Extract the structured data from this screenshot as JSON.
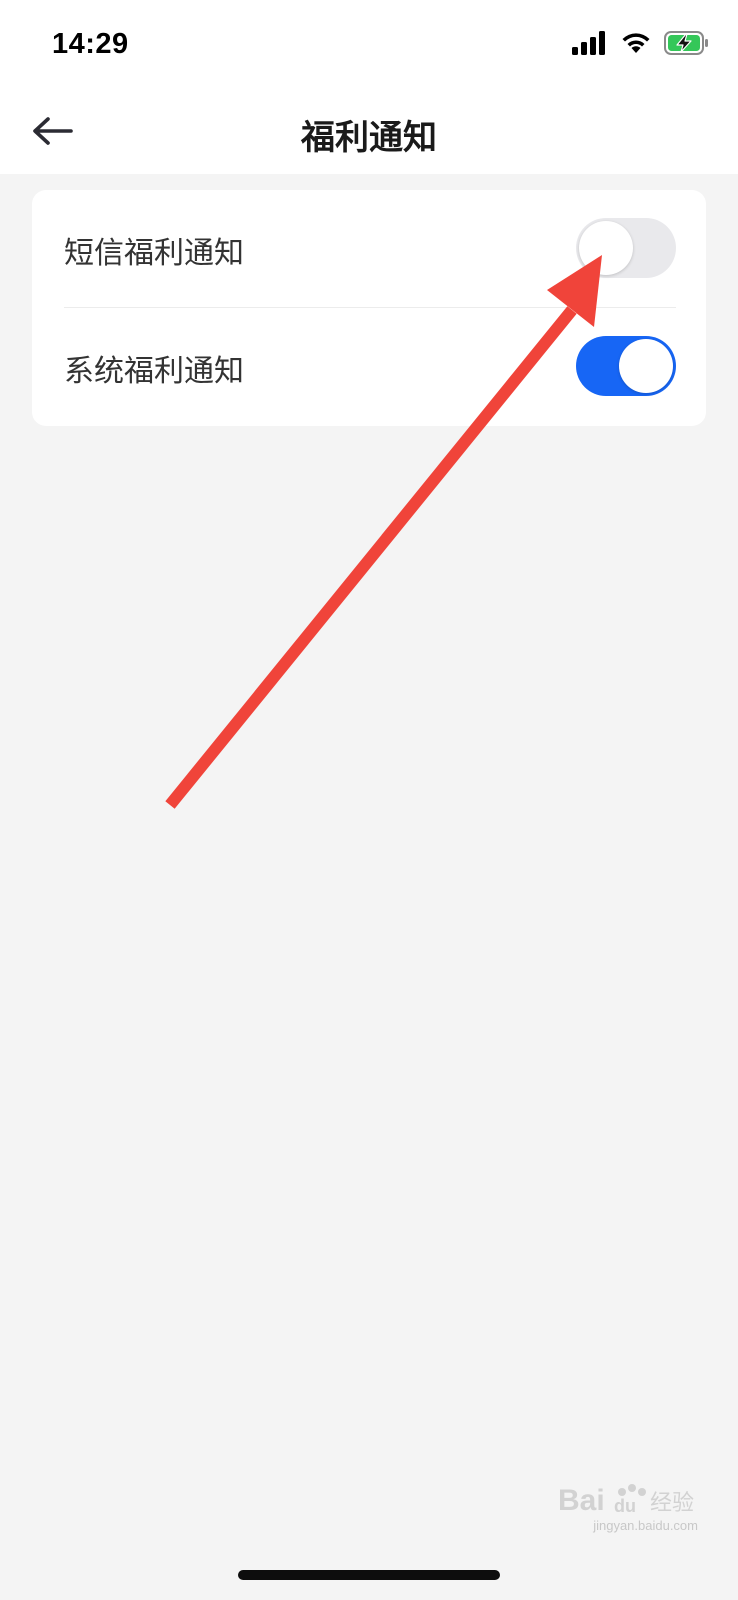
{
  "status_bar": {
    "time": "14:29",
    "icons": [
      "signal-icon",
      "wifi-icon",
      "battery-charging-icon"
    ]
  },
  "header": {
    "title": "福利通知",
    "back_icon": "back-arrow-icon"
  },
  "settings": [
    {
      "label": "短信福利通知",
      "enabled": false
    },
    {
      "label": "系统福利通知",
      "enabled": true
    }
  ],
  "colors": {
    "accent": "#1766f5",
    "toggle_off": "#e9e9ec",
    "annotation_arrow": "#f0443a",
    "background": "#f4f4f4"
  },
  "watermark": {
    "text": "jingyan.baidu.com"
  }
}
